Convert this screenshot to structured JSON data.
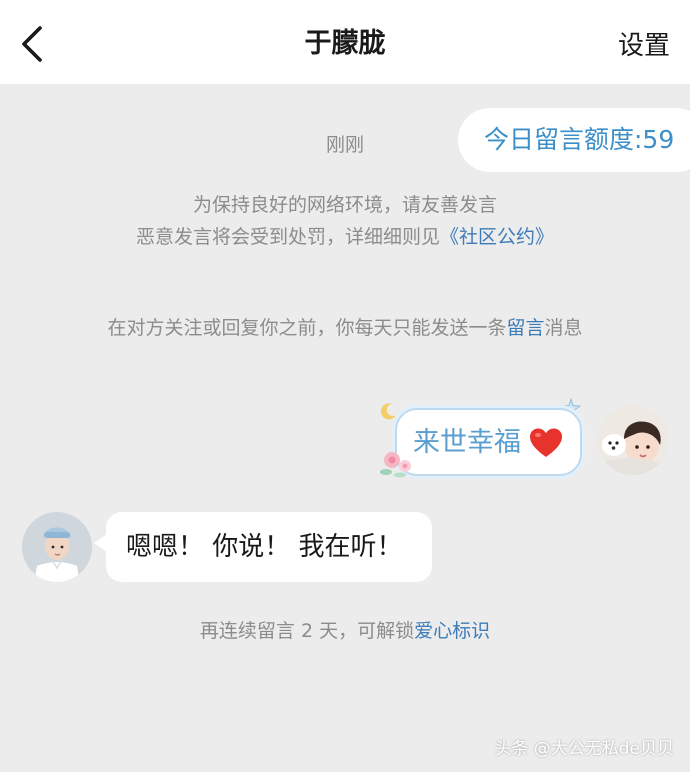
{
  "header": {
    "title": "于朦胧",
    "settings_label": "设置"
  },
  "quota": {
    "label": "今日留言额度:59"
  },
  "chat": {
    "timestamp": "刚刚",
    "notice_line1": "为保持良好的网络环境，请友善发言",
    "notice_line2_prefix": "恶意发言将会受到处罚，详细细则见",
    "notice_line2_link": "《社区公约》",
    "notice_line3_prefix": "在对方关注或回复你之前，你每天只能发送一条",
    "notice_line3_link": "留言",
    "notice_line3_suffix": "消息",
    "sent_message": "来世幸福",
    "received_message": "嗯嗯！ 你说！ 我在听！",
    "reward_prefix": "再连续留言 2 天，可解锁",
    "reward_link": "爱心标识"
  },
  "watermark": "头条 @大公无私de贝贝",
  "colors": {
    "background": "#ececec",
    "link": "#3d7cb8",
    "quota_text": "#3d8fc9",
    "sent_text": "#5a9fcf",
    "heart": "#e8332c"
  },
  "icons": {
    "back": "chevron-left-icon",
    "heart": "heart-icon",
    "moon": "moon-icon",
    "star": "star-icon",
    "flower": "flower-icon"
  }
}
